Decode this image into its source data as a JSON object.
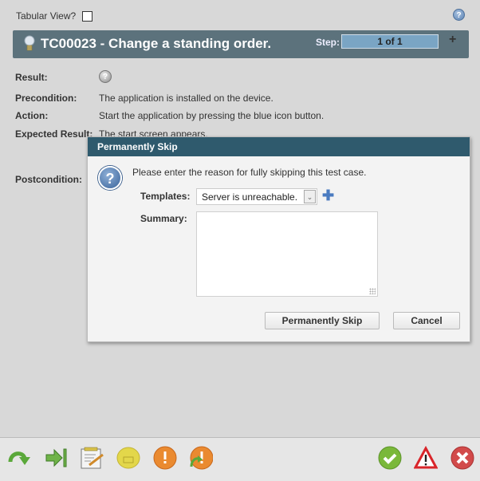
{
  "header": {
    "tabular_view_label": "Tabular View?",
    "tabular_view_checked": false,
    "help_icon": "help-icon"
  },
  "testcase": {
    "icon": "lightbulb-icon",
    "title": "TC00023 - Change a standing order.",
    "step_label": "Step:",
    "step_value": "1 of 1",
    "add_icon": "plus-icon"
  },
  "details": {
    "result_label": "Result:",
    "result_icon": "help-icon",
    "precondition_label": "Precondition:",
    "precondition_value": "The application is installed on the device.",
    "action_label": "Action:",
    "action_value": "Start the application by pressing the blue icon button.",
    "expected_label": "Expected Result:",
    "expected_value": "The start screen appears.",
    "postcondition_label": "Postcondition:"
  },
  "dialog": {
    "title": "Permanently Skip",
    "icon": "question-icon",
    "message": "Please enter the reason for fully skipping this test case.",
    "templates_label": "Templates:",
    "templates_value": "Server is unreachable.",
    "summary_label": "Summary:",
    "summary_value": "",
    "confirm_label": "Permanently Skip",
    "cancel_label": "Cancel"
  },
  "toolbar": {
    "left_icons": [
      "redo-arrow-icon",
      "skip-to-end-icon",
      "notepad-edit-icon",
      "hardhat-icon",
      "warning-orange-icon",
      "warning-retry-icon"
    ],
    "right_icons": [
      "pass-check-icon",
      "alert-triangle-icon",
      "fail-x-icon"
    ]
  },
  "colors": {
    "titlebar": "#5c727c",
    "dialog_header": "#2f5a6d",
    "step_box": "#7aa5c4"
  }
}
